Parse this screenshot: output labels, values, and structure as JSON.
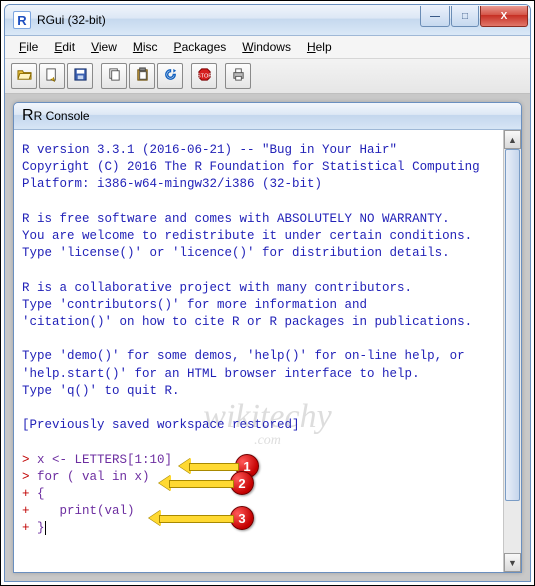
{
  "window": {
    "title": "RGui (32-bit)",
    "icon_letter": "R"
  },
  "window_buttons": {
    "minimize": "—",
    "maximize": "□",
    "close": "X"
  },
  "menu": {
    "items": [
      {
        "label": "File",
        "u": "F"
      },
      {
        "label": "Edit",
        "u": "E"
      },
      {
        "label": "View",
        "u": "V"
      },
      {
        "label": "Misc",
        "u": "M"
      },
      {
        "label": "Packages",
        "u": "P"
      },
      {
        "label": "Windows",
        "u": "W"
      },
      {
        "label": "Help",
        "u": "H"
      }
    ]
  },
  "toolbar": {
    "open": "open-icon",
    "source": "source-icon",
    "save": "save-icon",
    "copy": "copy-icon",
    "paste": "paste-icon",
    "refresh": "refresh-icon",
    "stop": "stop-icon",
    "print": "print-icon"
  },
  "console": {
    "title": "R Console",
    "icon_letter": "R",
    "lines": {
      "l1": "R version 3.3.1 (2016-06-21) -- \"Bug in Your Hair\"",
      "l2": "Copyright (C) 2016 The R Foundation for Statistical Computing",
      "l3": "Platform: i386-w64-mingw32/i386 (32-bit)",
      "l4": "",
      "l5": "R is free software and comes with ABSOLUTELY NO WARRANTY.",
      "l6": "You are welcome to redistribute it under certain conditions.",
      "l7": "Type 'license()' or 'licence()' for distribution details.",
      "l8": "",
      "l9": "R is a collaborative project with many contributors.",
      "l10": "Type 'contributors()' for more information and",
      "l11": "'citation()' on how to cite R or R packages in publications.",
      "l12": "",
      "l13": "Type 'demo()' for some demos, 'help()' for on-line help, or",
      "l14": "'help.start()' for an HTML browser interface to help.",
      "l15": "Type 'q()' to quit R.",
      "l16": "",
      "l17": "[Previously saved workspace restored]",
      "l18": "",
      "p1": "> ",
      "c1": "x <- LETTERS[1:10]",
      "p2": "> ",
      "c2": "for ( val in x)",
      "p3": "+ ",
      "c3": "{",
      "p4": "+    ",
      "c4": "print(val)",
      "p5": "+ ",
      "c5": "}"
    }
  },
  "annotations": {
    "a1": "1",
    "a2": "2",
    "a3": "3"
  },
  "watermark": {
    "main": "wikitechy",
    "sub": ".com"
  }
}
